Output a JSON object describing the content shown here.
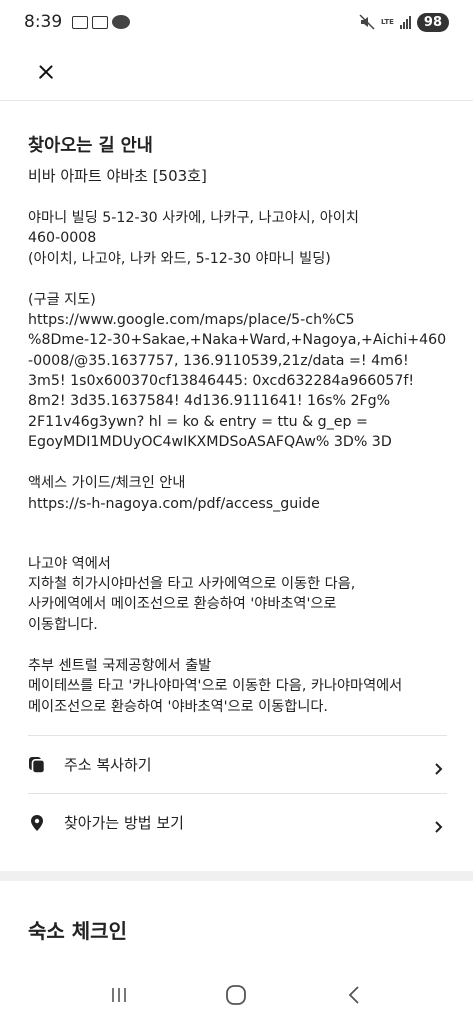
{
  "status": {
    "time": "8:39",
    "network": "LTE",
    "battery": "98"
  },
  "header": {
    "close_icon": "close-icon"
  },
  "directions": {
    "title": "찾아오는 길 안내",
    "subtitle": "비바 아파트 야바초 [503호]",
    "address": "야마니 빌딩 5-12-30 사카에, 나카구, 나고야시, 아이치\n460-0008\n(아이치, 나고야, 나카 와드, 5-12-30 야마니 빌딩)",
    "map_link": "(구글 지도)\nhttps://www.google.com/maps/place/5-ch%C5\n%8Dme-12-30+Sakae,+Naka+Ward,+Nagoya,+Aichi+460\n-0008/@35.1637757, 136.9110539,21z/data =! 4m6!\n3m5! 1s0x600370cf13846445: 0xcd632284a966057f!\n8m2! 3d35.1637584! 4d136.9111641! 16s% 2Fg%\n2F11v46g3ywn? hl = ko & entry = ttu & g_ep =\nEgoyMDI1MDUyOC4wIKXMDSoASAFQAw% 3D% 3D",
    "access_guide": "액세스 가이드/체크인 안내\nhttps://s-h-nagoya.com/pdf/access_guide",
    "from_nagoya": "나고야 역에서\n지하철 히가시야마선을 타고 사카에역으로 이동한 다음,\n사카에역에서 메이조선으로 환승하여 '야바초역'으로\n이동합니다.",
    "from_airport": "추부 센트럴 국제공항에서 출발\n메이테쓰를 타고 '카나야마역'으로 이동한 다음, 카나야마역에서\n메이조선으로 환승하여 '야바초역'으로 이동합니다."
  },
  "actions": [
    {
      "label": "주소 복사하기",
      "icon": "copy-icon"
    },
    {
      "label": "찾아가는 방법 보기",
      "icon": "map-pin-icon"
    }
  ],
  "checkin": {
    "title": "숙소 체크인"
  },
  "nav": {
    "recents_icon": "recents-icon",
    "home_icon": "home-icon",
    "back_icon": "back-icon"
  }
}
